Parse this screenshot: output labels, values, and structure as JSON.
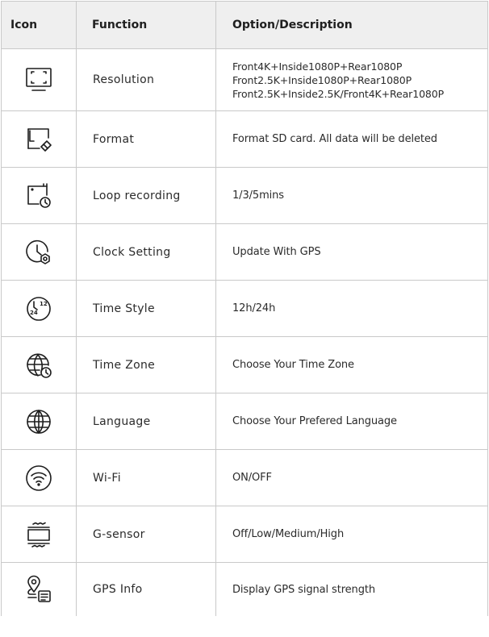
{
  "headers": {
    "icon": "Icon",
    "function": "Function",
    "option": "Option/Description"
  },
  "rows": [
    {
      "icon": "resolution-icon",
      "function": "Resolution",
      "options": [
        "Front4K+Inside1080P+Rear1080P",
        "Front2.5K+Inside1080P+Rear1080P",
        "Front2.5K+Inside2.5K/Front4K+Rear1080P"
      ]
    },
    {
      "icon": "format-icon",
      "function": "Format",
      "options": [
        "Format SD card. All data will be deleted"
      ]
    },
    {
      "icon": "loop-recording-icon",
      "function": "Loop recording",
      "options": [
        "1/3/5mins"
      ]
    },
    {
      "icon": "clock-setting-icon",
      "function": "Clock Setting",
      "options": [
        "Update With GPS"
      ]
    },
    {
      "icon": "time-style-icon",
      "function": "Time Style",
      "options": [
        "12h/24h"
      ],
      "icon_text": [
        "24",
        "12"
      ]
    },
    {
      "icon": "time-zone-icon",
      "function": "Time Zone",
      "options": [
        "Choose Your Time Zone"
      ]
    },
    {
      "icon": "language-icon",
      "function": "Language",
      "options": [
        "Choose Your Prefered Language"
      ]
    },
    {
      "icon": "wifi-icon",
      "function": "Wi-Fi",
      "options": [
        "ON/OFF"
      ]
    },
    {
      "icon": "g-sensor-icon",
      "function": "G-sensor",
      "options": [
        "Off/Low/Medium/High"
      ]
    },
    {
      "icon": "gps-info-icon",
      "function": "GPS Info",
      "options": [
        "Display GPS signal strength"
      ]
    }
  ]
}
